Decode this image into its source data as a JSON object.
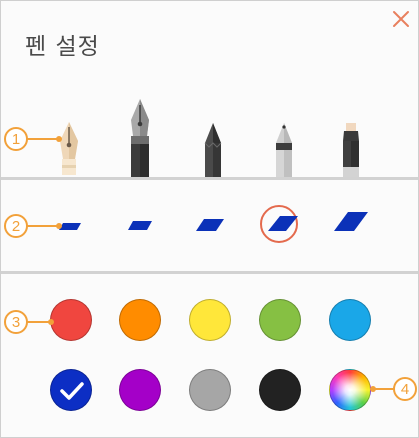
{
  "panel": {
    "title": "펜 설정"
  },
  "icons": {
    "close": "close-icon",
    "check": "check-icon",
    "spectrum": "color-wheel-icon"
  },
  "callouts": [
    "1",
    "2",
    "3",
    "4"
  ],
  "accent": "#f2a13a",
  "pens": [
    {
      "name": "fountain-pen-gold",
      "selected": true
    },
    {
      "name": "fountain-pen-black",
      "selected": false
    },
    {
      "name": "pencil",
      "selected": false
    },
    {
      "name": "ballpoint-pen",
      "selected": false
    },
    {
      "name": "marker",
      "selected": false
    }
  ],
  "thickness": {
    "levels": 5,
    "selected_index": 3
  },
  "colors": [
    {
      "hex": "#f0463f"
    },
    {
      "hex": "#ff8c00"
    },
    {
      "hex": "#ffe73a"
    },
    {
      "hex": "#86c043"
    },
    {
      "hex": "#1aa7e8"
    },
    {
      "hex": "#0c2ec4",
      "selected": true
    },
    {
      "hex": "#a400c8"
    },
    {
      "hex": "#a6a6a6"
    },
    {
      "hex": "#222222"
    },
    {
      "hex": "spectrum"
    }
  ]
}
